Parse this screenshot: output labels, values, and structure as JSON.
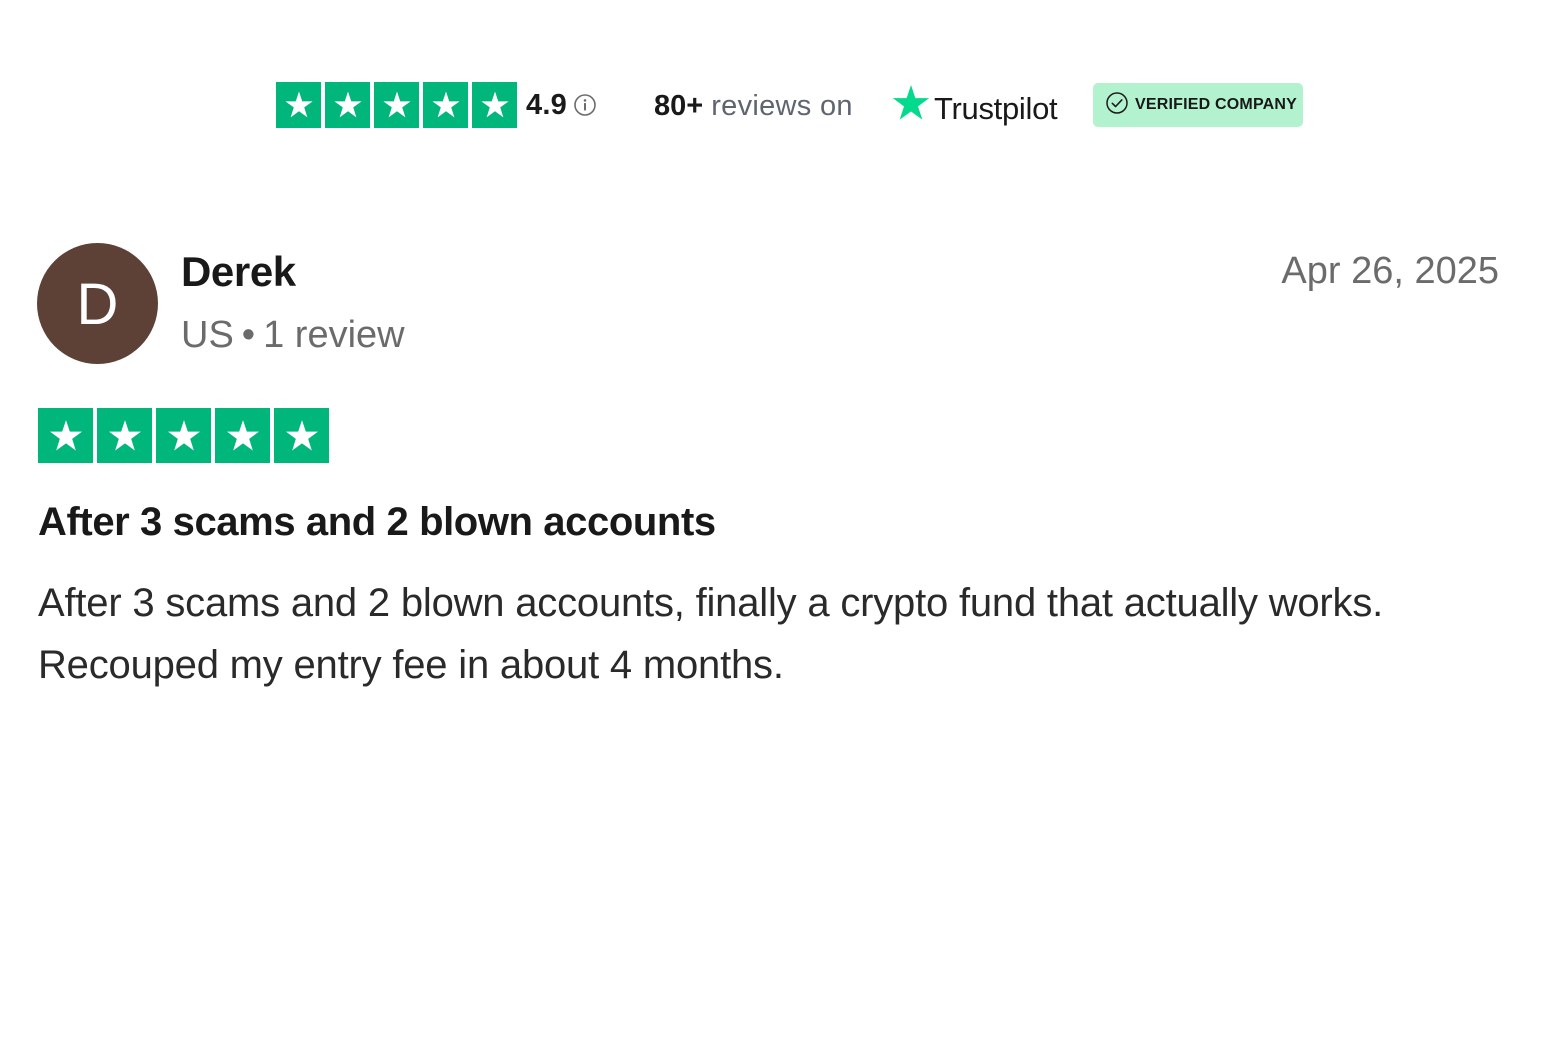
{
  "header": {
    "star_count": 5,
    "score": "4.9",
    "reviews_count": "80+",
    "reviews_suffix": "reviews on",
    "brand_name": "Trustpilot",
    "verified_label": "VERIFIED COMPANY",
    "icons": [
      "star-icon",
      "info-icon",
      "trustpilot-star-icon",
      "check-circle-icon"
    ]
  },
  "review": {
    "avatar_letter": "D",
    "reviewer_name": "Derek",
    "country": "US",
    "review_count_text": "1 review",
    "date": "Apr 26, 2025",
    "rating": 5,
    "title": "After 3 scams and 2 blown accounts",
    "body": "After 3 scams and 2 blown accounts, finally a crypto fund that actually works. Recouped my entry fee in about 4 months."
  },
  "colors": {
    "star_green": "#00b67a",
    "brand_green": "#04da8d",
    "badge_bg": "#b3f2cf",
    "avatar_bg": "#5e4136"
  }
}
